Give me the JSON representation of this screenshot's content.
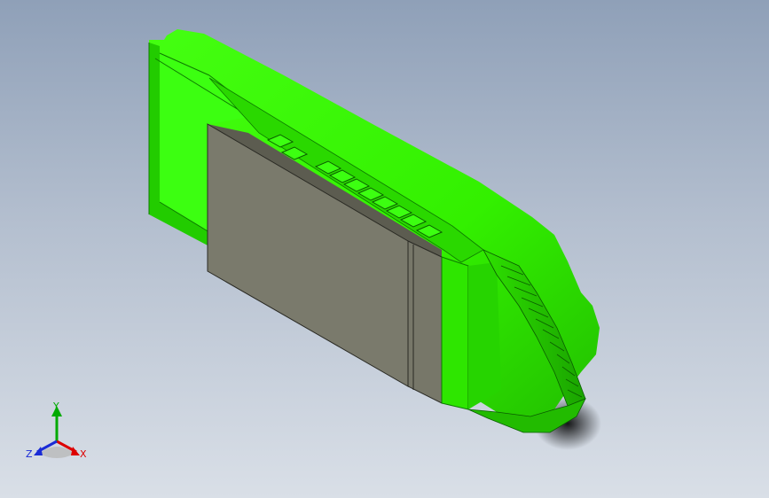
{
  "viewport": {
    "background_top": "#8fa0b8",
    "background_bottom": "#d9dfe7"
  },
  "model": {
    "body_color": "#33ff00",
    "body_shade": "#22cc00",
    "body_dark": "#119900",
    "label_color": "#7a7a6c",
    "label_edge": "#2a2a24"
  },
  "triad": {
    "y_label": "Y",
    "x_label": "X",
    "z_label": "Z",
    "y_color": "#00aa00",
    "x_color": "#dd0000",
    "z_color": "#1a2bd6"
  }
}
